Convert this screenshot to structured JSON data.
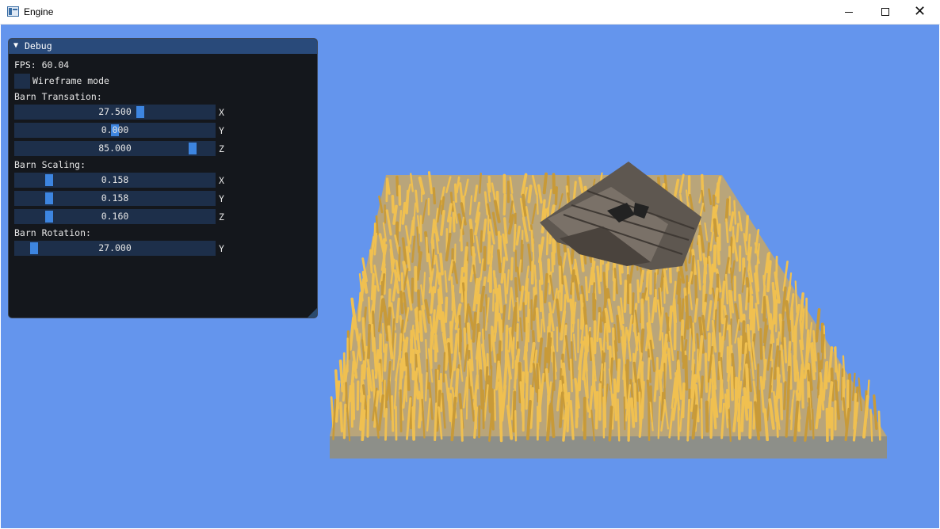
{
  "window": {
    "title": "Engine",
    "minimize_icon": "minimize-icon",
    "maximize_icon": "maximize-icon",
    "close_icon": "close-icon",
    "close_glyph": "✕"
  },
  "debug": {
    "title": "Debug",
    "collapse_arrow": "▼",
    "fps": "FPS: 60.04",
    "wireframe_label": "Wireframe mode",
    "wireframe_checked": false,
    "translation_label": "Barn Transation:",
    "translation": [
      {
        "value": "27.500",
        "fraction": 0.63,
        "axis": "X"
      },
      {
        "value": "0.000",
        "fraction": 0.5,
        "axis": "Y"
      },
      {
        "value": "85.000",
        "fraction": 0.9,
        "axis": "Z"
      }
    ],
    "scaling_label": "Barn Scaling:",
    "scaling": [
      {
        "value": "0.158",
        "fraction": 0.16,
        "axis": "X"
      },
      {
        "value": "0.158",
        "fraction": 0.16,
        "axis": "Y"
      },
      {
        "value": "0.160",
        "fraction": 0.16,
        "axis": "Z"
      }
    ],
    "rotation_label": "Barn Rotation:",
    "rotation": [
      {
        "value": "27.000",
        "fraction": 0.08,
        "axis": "Y"
      }
    ]
  },
  "colors": {
    "background": "#6495ed",
    "wheat": "#f0c050",
    "wheat_dark": "#c89a38",
    "ground": "#9a9a92",
    "barn": "#6b625a",
    "panel": "#0f0f0f",
    "header": "#294a7a",
    "slider_bg": "#1d2f4a",
    "slider_grab": "#3d85e0"
  }
}
